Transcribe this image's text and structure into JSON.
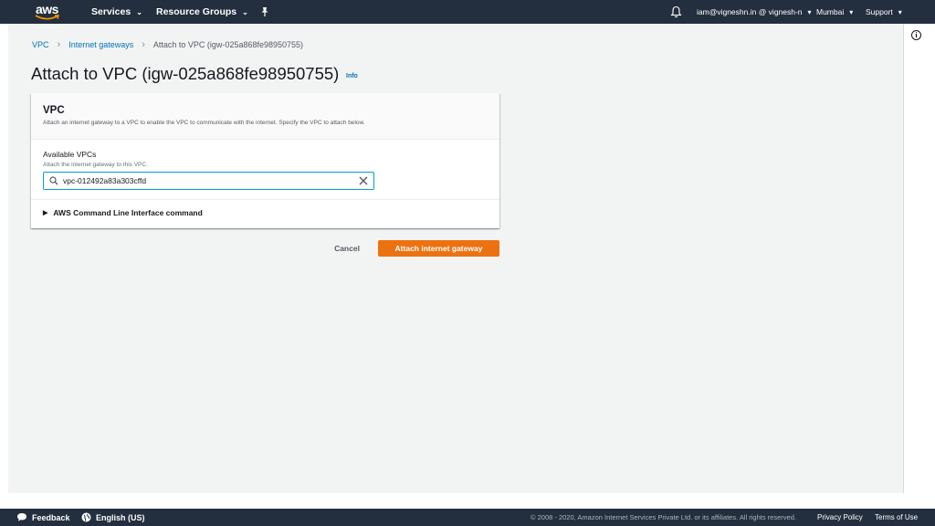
{
  "topnav": {
    "logo_text": "aws",
    "services_label": "Services",
    "resource_groups_label": "Resource Groups",
    "account_label": "iam@vigneshn.in @ vignesh-n",
    "region_label": "Mumbai",
    "support_label": "Support"
  },
  "breadcrumb": {
    "items": [
      "VPC",
      "Internet gateways"
    ],
    "current": "Attach to VPC (igw-025a868fe98950755)"
  },
  "page": {
    "title": "Attach to VPC (igw-025a868fe98950755)",
    "info_label": "Info"
  },
  "panel": {
    "title": "VPC",
    "description": "Attach an internet gateway to a VPC to enable the VPC to communicate with the internet. Specify the VPC to attach below.",
    "field_label": "Available VPCs",
    "field_description": "Attach the internet gateway to this VPC.",
    "search_value": "vpc-012492a83a303cffd",
    "cli_label": "AWS Command Line Interface command"
  },
  "actions": {
    "cancel_label": "Cancel",
    "primary_label": "Attach internet gateway"
  },
  "footer": {
    "feedback_label": "Feedback",
    "language_label": "English (US)",
    "copyright": "© 2008 - 2020, Amazon Internet Services Private Ltd. or its affiliates. All rights reserved.",
    "privacy_label": "Privacy Policy",
    "terms_label": "Terms of Use"
  },
  "colors": {
    "nav_bg": "#232f3e",
    "link": "#0073bb",
    "primary": "#ec7211",
    "focus": "#00a1c9",
    "page_bg": "#f2f3f3"
  }
}
